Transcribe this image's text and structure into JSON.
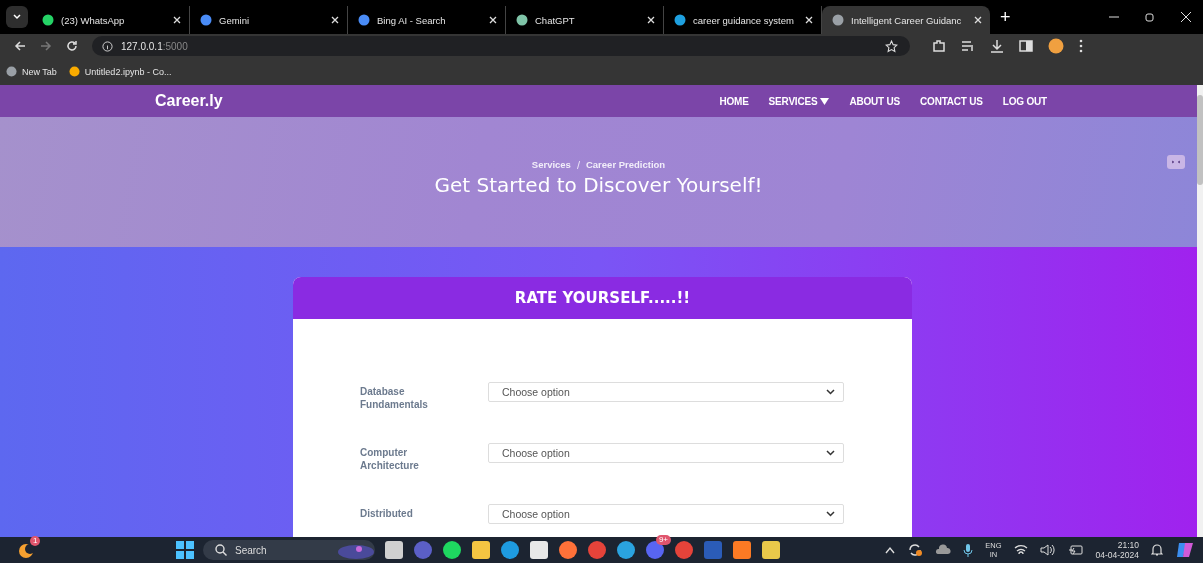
{
  "browser": {
    "tabs": [
      {
        "title": "(23) WhatsApp",
        "kind": "whatsapp",
        "selected": false
      },
      {
        "title": "Gemini",
        "kind": "gemini",
        "selected": false
      },
      {
        "title": "Bing AI - Search",
        "kind": "search",
        "selected": false
      },
      {
        "title": "ChatGPT",
        "kind": "chatgpt",
        "selected": false
      },
      {
        "title": "career guidance system",
        "kind": "k",
        "selected": false
      },
      {
        "title": "Intelligent Career Guidanc",
        "kind": "globe",
        "selected": true
      }
    ],
    "new_tab": "+",
    "address_host": "127.0.0.1",
    "address_port": ":5000",
    "bookmarks": [
      {
        "title": "New Tab",
        "kind": "globe"
      },
      {
        "title": "Untitled2.ipynb - Co...",
        "kind": "colab"
      }
    ]
  },
  "navbar": {
    "brand": "Career.ly",
    "links": [
      {
        "label": "HOME",
        "dropdown": false
      },
      {
        "label": "SERVICES",
        "dropdown": true
      },
      {
        "label": "ABOUT US",
        "dropdown": false
      },
      {
        "label": "CONTACT US",
        "dropdown": false
      },
      {
        "label": "LOG OUT",
        "dropdown": false
      }
    ]
  },
  "hero": {
    "breadcrumb": [
      "Services",
      "Career Prediction"
    ],
    "breadcrumb_separator": "/",
    "title": "Get Started to Discover Yourself!"
  },
  "form": {
    "title": "RATE YOURSELF.....!!",
    "fields": [
      {
        "label": "Database Fundamentals",
        "value": "Choose option"
      },
      {
        "label": "Computer Architecture",
        "value": "Choose option"
      },
      {
        "label": "Distributed",
        "value": "Choose option"
      }
    ]
  },
  "taskbar": {
    "search_placeholder": "Search",
    "apps": [
      {
        "kind": "taskview"
      },
      {
        "kind": "teams"
      },
      {
        "kind": "spotify"
      },
      {
        "kind": "files"
      },
      {
        "kind": "edge"
      },
      {
        "kind": "store"
      },
      {
        "kind": "firefox"
      },
      {
        "kind": "chrome"
      },
      {
        "kind": "telegram"
      },
      {
        "kind": "discord",
        "badge": "9+"
      },
      {
        "kind": "chrome"
      },
      {
        "kind": "word"
      },
      {
        "kind": "xampp"
      },
      {
        "kind": "python"
      }
    ],
    "weather_badge": "1",
    "lang": "ENG",
    "region": "IN",
    "time": "21:10",
    "date": "04-04-2024"
  }
}
